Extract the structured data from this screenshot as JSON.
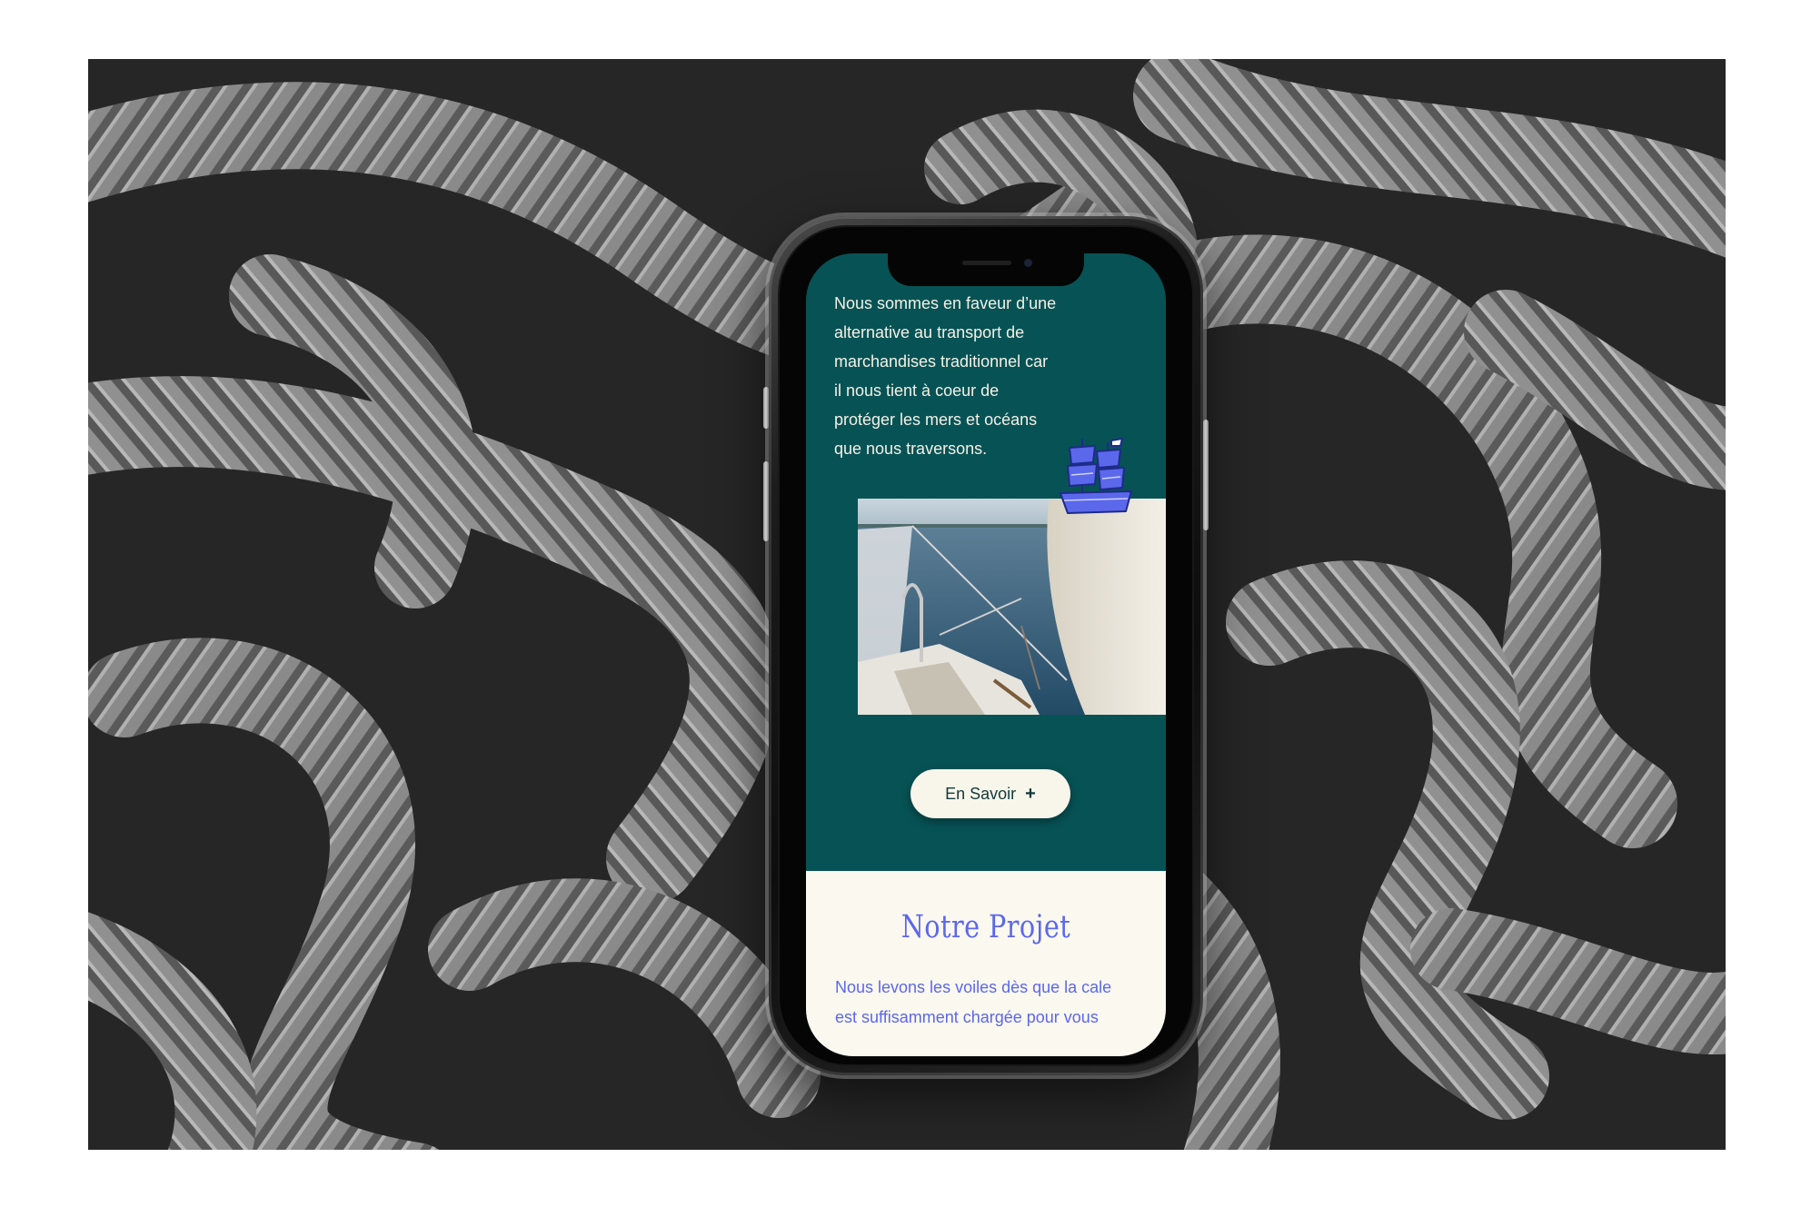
{
  "screen": {
    "intro_text": "Nous sommes en faveur d’une\nalternative au transport de\nmarchandises traditionnel car\nil nous tient à coeur de\nprotéger  les mers et océans\nque nous traversons.",
    "cta_label": "En Savoir",
    "cta_icon": "+",
    "project_title": "Notre Projet",
    "project_text": "Nous levons les voiles dès que la cale\nest suffisamment chargée pour vous"
  },
  "colors": {
    "teal_background": "#075255",
    "cream": "#fbf8ef",
    "accent_blue": "#5b68ec"
  },
  "icons": {
    "ship": "sailing-ship-icon",
    "plus": "plus-icon"
  }
}
